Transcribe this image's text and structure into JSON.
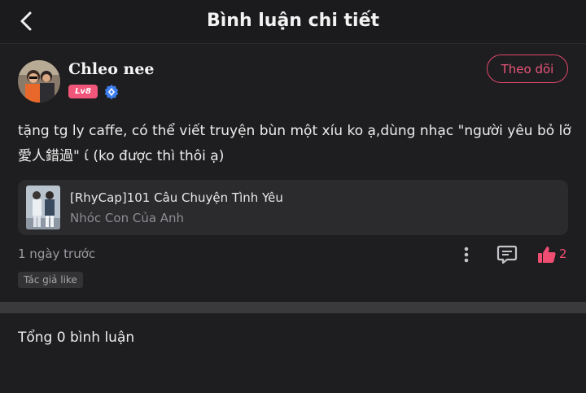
{
  "header": {
    "title": "Bình luận chi tiết",
    "back_icon": "chevron-left-icon"
  },
  "user": {
    "name": "Chleo nee",
    "level": "Lv8",
    "verified_icon": "verified-badge-icon",
    "follow_label": "Theo dõi"
  },
  "comment": {
    "text": "tặng tg ly caffe, có thể viết truyện bùn một xíu ko ạ,dùng nhạc \"người yêu bỏ lỡ 愛人錯過\" ί (ko được thì thôi ạ)"
  },
  "story_card": {
    "title": "[RhyCap]101 Câu Chuyện Tình Yêu",
    "subtitle": "Nhóc Con Của Anh"
  },
  "meta": {
    "time": "1 ngày trước",
    "like_count": "2",
    "author_tag": "Tác giả like"
  },
  "summary": {
    "total_label": "Tổng 0 bình luận"
  },
  "colors": {
    "accent": "#ef4d72",
    "background": "#1e1e20",
    "card": "#2b2b2e"
  }
}
